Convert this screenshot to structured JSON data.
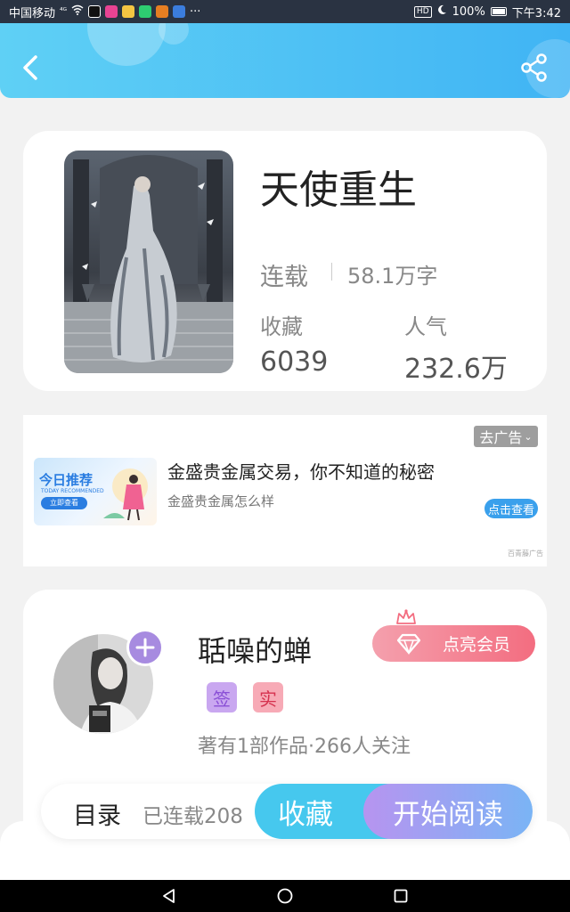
{
  "status_bar": {
    "carrier": "中国移动",
    "signal_text": "⁴ᴳ",
    "more": "···",
    "battery": "100%",
    "time": "下午3:42"
  },
  "book": {
    "title": "天使重生",
    "status": "连载",
    "word_count": "58.1万字",
    "favorites_label": "收藏",
    "favorites_value": "6039",
    "popularity_label": "人气",
    "popularity_value": "232.6万"
  },
  "ad": {
    "close_label": "去广告",
    "image_title": "今日推荐",
    "image_subtitle": "TODAY RECOMMENDED",
    "image_button": "立即查看",
    "headline": "金盛贵金属交易，你不知道的秘密",
    "subtitle": "金盛贵金属怎么样",
    "cta": "点击查看",
    "source": "百青藤广告"
  },
  "author": {
    "name": "聒噪的蝉",
    "vip_button": "点亮会员",
    "badge_sign": "签",
    "badge_real": "实",
    "stats": "著有1部作品·266人关注"
  },
  "actions": {
    "toc": "目录",
    "serial_count": "已连载208",
    "collect": "收藏",
    "read": "开始阅读"
  },
  "colors": {
    "header_gradient_start": "#5fd0f5",
    "header_gradient_end": "#40b4f4",
    "collect_button": "#46c8ee",
    "vip_button": "#f36d80",
    "follow_plus": "#a78be0"
  }
}
